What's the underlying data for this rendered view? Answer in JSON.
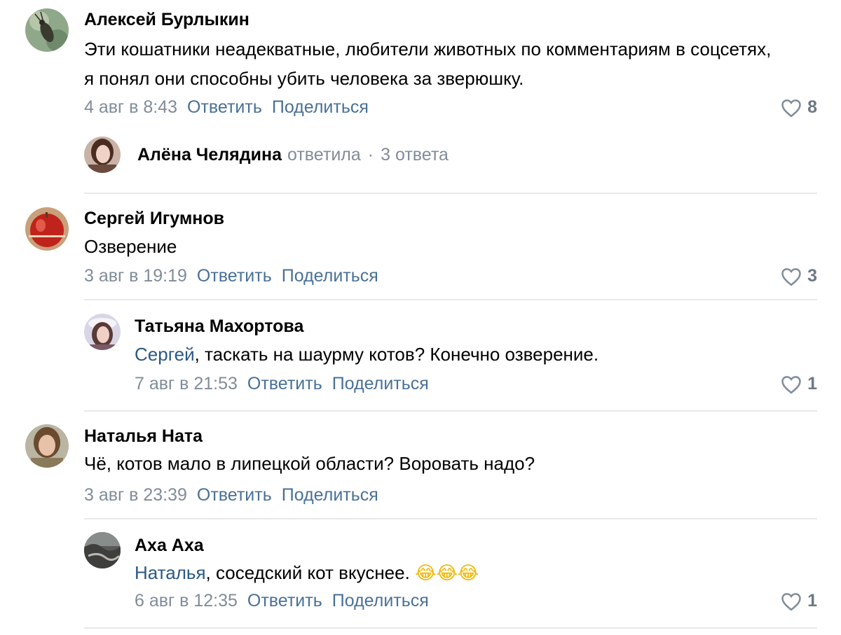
{
  "comments": [
    {
      "author": "Алексей Бурлыкин",
      "text": "Эти кошатники неадекватные, любители животных по комментариям в соцсетях, я понял они способны убить человека за зверюшку.",
      "date": "4 авг в 8:43",
      "reply_label": "Ответить",
      "share_label": "Поделиться",
      "likes": "8",
      "avatar_icon": "beetle-photo"
    },
    {
      "author": "Сергей Игумнов",
      "text": "Озверение",
      "date": "3 авг в 19:19",
      "reply_label": "Ответить",
      "share_label": "Поделиться",
      "likes": "3",
      "avatar_icon": "apple-photo"
    },
    {
      "author": "Наталья Ната",
      "text": "Чё, котов мало в липецкой области? Воровать надо?",
      "date": "3 авг в 23:39",
      "reply_label": "Ответить",
      "share_label": "Поделиться",
      "likes": "",
      "avatar_icon": "woman-photo"
    }
  ],
  "thread_summary": {
    "author": "Алёна Челядина",
    "verb": "ответила",
    "separator": "·",
    "count": "3 ответа"
  },
  "replies": [
    {
      "author": "Татьяна Махортова",
      "mention": "Сергей",
      "text": ", таскать на шаурму котов? Конечно озверение.",
      "date": "7 авг в 21:53",
      "reply_label": "Ответить",
      "share_label": "Поделиться",
      "likes": "1"
    },
    {
      "author": "Аха Аха",
      "mention": "Наталья",
      "text": ", соседский кот вкуснее.",
      "emoji": "😂😂😂",
      "date": "6 авг в 12:35",
      "reply_label": "Ответить",
      "share_label": "Поделиться",
      "likes": "1"
    }
  ],
  "colors": {
    "link": "#2a5885",
    "meta": "#818c99",
    "divider": "#e7e8ec"
  }
}
